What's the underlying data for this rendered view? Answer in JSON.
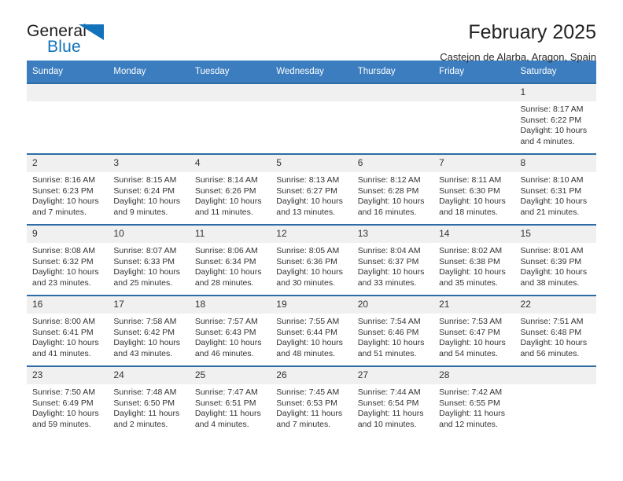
{
  "brand": {
    "name_top": "General",
    "name_bottom": "Blue",
    "accent_color": "#1272ba",
    "triangle_icon": "brand-triangle-icon"
  },
  "header": {
    "title": "February 2025",
    "subtitle": "Castejon de Alarba, Aragon, Spain"
  },
  "calendar": {
    "header_bg": "#3b7dbf",
    "cell_top_border": "#2e6da4",
    "daynum_bg": "#f0f0f0",
    "weekdays": [
      "Sunday",
      "Monday",
      "Tuesday",
      "Wednesday",
      "Thursday",
      "Friday",
      "Saturday"
    ],
    "weeks": [
      [
        {
          "day": "",
          "empty": true
        },
        {
          "day": "",
          "empty": true
        },
        {
          "day": "",
          "empty": true
        },
        {
          "day": "",
          "empty": true
        },
        {
          "day": "",
          "empty": true
        },
        {
          "day": "",
          "empty": true
        },
        {
          "day": "1",
          "sunrise": "Sunrise: 8:17 AM",
          "sunset": "Sunset: 6:22 PM",
          "daylight": "Daylight: 10 hours and 4 minutes."
        }
      ],
      [
        {
          "day": "2",
          "sunrise": "Sunrise: 8:16 AM",
          "sunset": "Sunset: 6:23 PM",
          "daylight": "Daylight: 10 hours and 7 minutes."
        },
        {
          "day": "3",
          "sunrise": "Sunrise: 8:15 AM",
          "sunset": "Sunset: 6:24 PM",
          "daylight": "Daylight: 10 hours and 9 minutes."
        },
        {
          "day": "4",
          "sunrise": "Sunrise: 8:14 AM",
          "sunset": "Sunset: 6:26 PM",
          "daylight": "Daylight: 10 hours and 11 minutes."
        },
        {
          "day": "5",
          "sunrise": "Sunrise: 8:13 AM",
          "sunset": "Sunset: 6:27 PM",
          "daylight": "Daylight: 10 hours and 13 minutes."
        },
        {
          "day": "6",
          "sunrise": "Sunrise: 8:12 AM",
          "sunset": "Sunset: 6:28 PM",
          "daylight": "Daylight: 10 hours and 16 minutes."
        },
        {
          "day": "7",
          "sunrise": "Sunrise: 8:11 AM",
          "sunset": "Sunset: 6:30 PM",
          "daylight": "Daylight: 10 hours and 18 minutes."
        },
        {
          "day": "8",
          "sunrise": "Sunrise: 8:10 AM",
          "sunset": "Sunset: 6:31 PM",
          "daylight": "Daylight: 10 hours and 21 minutes."
        }
      ],
      [
        {
          "day": "9",
          "sunrise": "Sunrise: 8:08 AM",
          "sunset": "Sunset: 6:32 PM",
          "daylight": "Daylight: 10 hours and 23 minutes."
        },
        {
          "day": "10",
          "sunrise": "Sunrise: 8:07 AM",
          "sunset": "Sunset: 6:33 PM",
          "daylight": "Daylight: 10 hours and 25 minutes."
        },
        {
          "day": "11",
          "sunrise": "Sunrise: 8:06 AM",
          "sunset": "Sunset: 6:34 PM",
          "daylight": "Daylight: 10 hours and 28 minutes."
        },
        {
          "day": "12",
          "sunrise": "Sunrise: 8:05 AM",
          "sunset": "Sunset: 6:36 PM",
          "daylight": "Daylight: 10 hours and 30 minutes."
        },
        {
          "day": "13",
          "sunrise": "Sunrise: 8:04 AM",
          "sunset": "Sunset: 6:37 PM",
          "daylight": "Daylight: 10 hours and 33 minutes."
        },
        {
          "day": "14",
          "sunrise": "Sunrise: 8:02 AM",
          "sunset": "Sunset: 6:38 PM",
          "daylight": "Daylight: 10 hours and 35 minutes."
        },
        {
          "day": "15",
          "sunrise": "Sunrise: 8:01 AM",
          "sunset": "Sunset: 6:39 PM",
          "daylight": "Daylight: 10 hours and 38 minutes."
        }
      ],
      [
        {
          "day": "16",
          "sunrise": "Sunrise: 8:00 AM",
          "sunset": "Sunset: 6:41 PM",
          "daylight": "Daylight: 10 hours and 41 minutes."
        },
        {
          "day": "17",
          "sunrise": "Sunrise: 7:58 AM",
          "sunset": "Sunset: 6:42 PM",
          "daylight": "Daylight: 10 hours and 43 minutes."
        },
        {
          "day": "18",
          "sunrise": "Sunrise: 7:57 AM",
          "sunset": "Sunset: 6:43 PM",
          "daylight": "Daylight: 10 hours and 46 minutes."
        },
        {
          "day": "19",
          "sunrise": "Sunrise: 7:55 AM",
          "sunset": "Sunset: 6:44 PM",
          "daylight": "Daylight: 10 hours and 48 minutes."
        },
        {
          "day": "20",
          "sunrise": "Sunrise: 7:54 AM",
          "sunset": "Sunset: 6:46 PM",
          "daylight": "Daylight: 10 hours and 51 minutes."
        },
        {
          "day": "21",
          "sunrise": "Sunrise: 7:53 AM",
          "sunset": "Sunset: 6:47 PM",
          "daylight": "Daylight: 10 hours and 54 minutes."
        },
        {
          "day": "22",
          "sunrise": "Sunrise: 7:51 AM",
          "sunset": "Sunset: 6:48 PM",
          "daylight": "Daylight: 10 hours and 56 minutes."
        }
      ],
      [
        {
          "day": "23",
          "sunrise": "Sunrise: 7:50 AM",
          "sunset": "Sunset: 6:49 PM",
          "daylight": "Daylight: 10 hours and 59 minutes."
        },
        {
          "day": "24",
          "sunrise": "Sunrise: 7:48 AM",
          "sunset": "Sunset: 6:50 PM",
          "daylight": "Daylight: 11 hours and 2 minutes."
        },
        {
          "day": "25",
          "sunrise": "Sunrise: 7:47 AM",
          "sunset": "Sunset: 6:51 PM",
          "daylight": "Daylight: 11 hours and 4 minutes."
        },
        {
          "day": "26",
          "sunrise": "Sunrise: 7:45 AM",
          "sunset": "Sunset: 6:53 PM",
          "daylight": "Daylight: 11 hours and 7 minutes."
        },
        {
          "day": "27",
          "sunrise": "Sunrise: 7:44 AM",
          "sunset": "Sunset: 6:54 PM",
          "daylight": "Daylight: 11 hours and 10 minutes."
        },
        {
          "day": "28",
          "sunrise": "Sunrise: 7:42 AM",
          "sunset": "Sunset: 6:55 PM",
          "daylight": "Daylight: 11 hours and 12 minutes."
        },
        {
          "day": "",
          "empty": true
        }
      ]
    ]
  }
}
